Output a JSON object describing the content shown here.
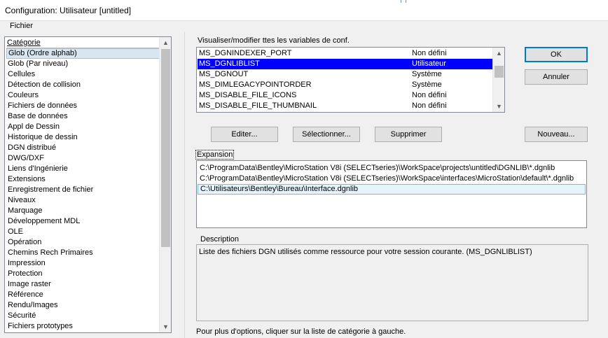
{
  "window": {
    "title": "Configuration: Utilisateur [untitled]"
  },
  "menubar": {
    "file": "Fichier"
  },
  "categories": {
    "header": "Catégorie",
    "items": [
      "Glob (Ordre alphab)",
      "Glob (Par niveau)",
      "Cellules",
      "Détection de collision",
      "Couleurs",
      "Fichiers de données",
      "Base de données",
      "Appl de Dessin",
      "Historique de dessin",
      "DGN distribué",
      "DWG/DXF",
      "Liens d'Ingénierie",
      "Extensions",
      "Enregistrement de fichier",
      "Niveaux",
      "Marquage",
      "Développement MDL",
      "OLE",
      "Opération",
      "Chemins Rech Primaires",
      "Impression",
      "Protection",
      "Image raster",
      "Référence",
      "Rendu/Images",
      "Sécurité",
      "Fichiers prototypes"
    ],
    "selected_index": 0
  },
  "variables": {
    "label": "Visualiser/modifier ttes les variables de conf.",
    "rows": [
      {
        "name": "MS_DGNINDEXER_PORT",
        "level": "Non défini"
      },
      {
        "name": "MS_DGNLIBLIST",
        "level": "Utilisateur"
      },
      {
        "name": "MS_DGNOUT",
        "level": "Système"
      },
      {
        "name": "MS_DIMLEGACYPOINTORDER",
        "level": "Système"
      },
      {
        "name": "MS_DISABLE_FILE_ICONS",
        "level": "Non défini"
      },
      {
        "name": "MS_DISABLE_FILE_THUMBNAIL",
        "level": "Non défini"
      }
    ],
    "selected_index": 1
  },
  "buttons": {
    "ok": "OK",
    "cancel": "Annuler",
    "edit": "Editer...",
    "select": "Sélectionner...",
    "delete": "Supprimer",
    "new": "Nouveau..."
  },
  "expansion": {
    "title": "Expansion",
    "rows": [
      "C:\\ProgramData\\Bentley\\MicroStation V8i (SELECTseries)\\WorkSpace\\projects\\untitled\\DGNLIB\\*.dgnlib",
      "C:\\ProgramData\\Bentley\\MicroStation V8i (SELECTseries)\\WorkSpace\\interfaces\\MicroStation\\default\\*.dgnlib",
      "C:\\Utilisateurs\\Bentley\\Bureau\\Interface.dgnlib"
    ]
  },
  "description": {
    "title": "Description",
    "text": "Liste des fichiers DGN utilisés comme ressource pour votre session courante. (MS_DGNLIBLIST)"
  },
  "footer": {
    "hint": "Pour plus d'options, cliquer sur la liste de catégorie à gauche."
  }
}
